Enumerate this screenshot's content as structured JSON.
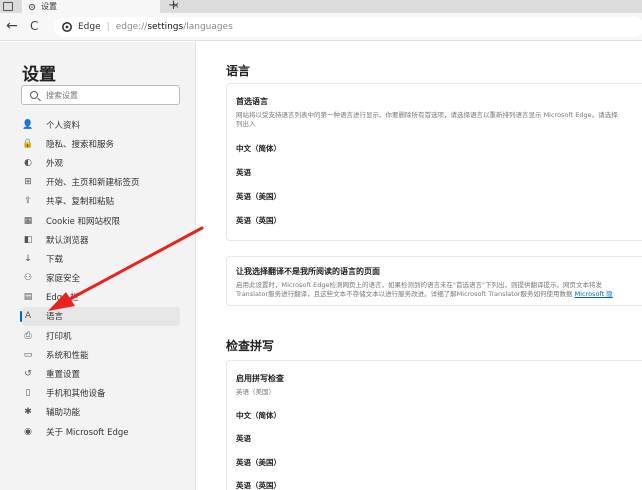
{
  "window": {
    "tab_title": "设置",
    "tab_close": "×",
    "new_tab": "+"
  },
  "addressbar": {
    "back": "←",
    "reload": "C",
    "brand": "Edge",
    "separator": "|",
    "url_prefix": "edge://",
    "url_bold": "settings",
    "url_suffix": "/languages"
  },
  "sidebar": {
    "title": "设置",
    "search_placeholder": "搜索设置",
    "items": [
      {
        "label": "个人资料",
        "icon": "👤"
      },
      {
        "label": "隐私、搜索和服务",
        "icon": "🔒"
      },
      {
        "label": "外观",
        "icon": "◐"
      },
      {
        "label": "开始、主页和新建标签页",
        "icon": "⊞"
      },
      {
        "label": "共享、复制和粘贴",
        "icon": "⇪"
      },
      {
        "label": "Cookie 和网站权限",
        "icon": "▦"
      },
      {
        "label": "默认浏览器",
        "icon": "◧"
      },
      {
        "label": "下载",
        "icon": "↓"
      },
      {
        "label": "家庭安全",
        "icon": "⚇"
      },
      {
        "label": "Edge 栏",
        "icon": "▤"
      },
      {
        "label": "语言",
        "icon": "A"
      },
      {
        "label": "打印机",
        "icon": "⎙"
      },
      {
        "label": "系统和性能",
        "icon": "▭"
      },
      {
        "label": "重置设置",
        "icon": "↺"
      },
      {
        "label": "手机和其他设备",
        "icon": "▯"
      },
      {
        "label": "辅助功能",
        "icon": "✱"
      },
      {
        "label": "关于 Microsoft Edge",
        "icon": "◉"
      }
    ],
    "active_index": 10
  },
  "main": {
    "section1_title": "语言",
    "preferred": {
      "title": "首选语言",
      "desc": "网站将以受支持语言列表中的第一种语言进行显示。你要删除所有首选项，请选择语言以重新排列语言显示 Microsoft Edge。请选择",
      "desc2": "列出入",
      "languages": [
        "中文（简体）",
        "英语",
        "英语（美国）",
        "英语（英国）"
      ]
    },
    "translate": {
      "title": "让我选择翻译不是我所阅读的语言的页面",
      "desc_line1": "启用此设置时，Microsoft Edge检测网页上的语言，如果检测到的语言未在\"首选语言\"下列出，则提供翻译提示。网页文本将发",
      "desc_line2": "Translator服务进行翻译，且这些文本不存储文本以进行服务改进。详细了解Microsoft Translator服务如何使用数据",
      "desc_link": "Microsoft 隐"
    },
    "section2_title": "检查拼写",
    "spell": {
      "title": "启用拼写检查",
      "desc": "英语（美国）",
      "languages": [
        "中文（简体）",
        "英语",
        "英语（美国）",
        "英语（英国）"
      ]
    }
  },
  "colors": {
    "accent": "#0067c0",
    "annotation_arrow": "#e8231f"
  }
}
